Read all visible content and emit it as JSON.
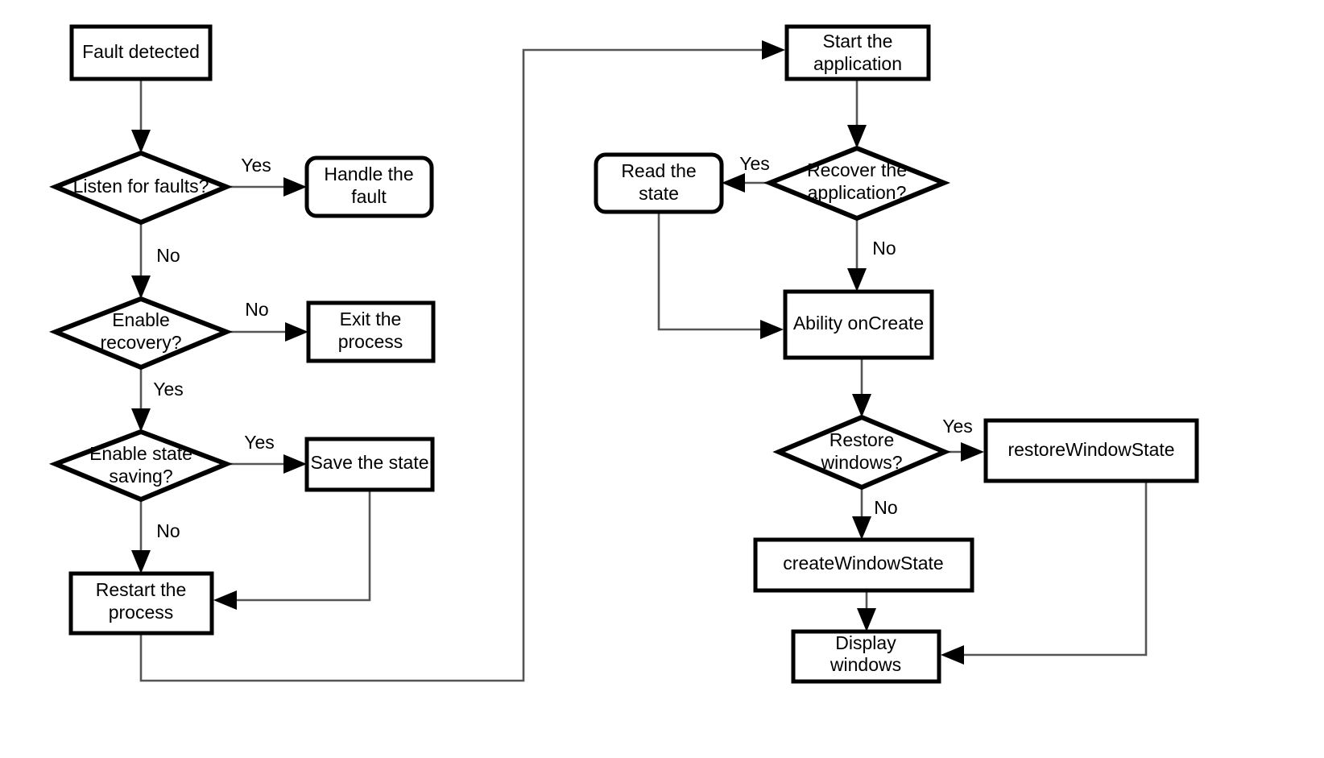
{
  "diagram": {
    "title": "Application fault recovery and window state restoration flowchart",
    "colors": {
      "node_fill": "#ffffff",
      "node_stroke": "#000000",
      "edge_stroke": "#555555",
      "text": "#000000"
    },
    "nodes": {
      "fault_detected": "Fault detected",
      "listen_for_faults": "Listen for faults?",
      "handle_the_fault_line1": "Handle the",
      "handle_the_fault_line2": "fault",
      "enable_recovery_line1": "Enable",
      "enable_recovery_line2": "recovery?",
      "exit_the_process_line1": "Exit the",
      "exit_the_process_line2": "process",
      "enable_state_saving_line1": "Enable state",
      "enable_state_saving_line2": "saving?",
      "save_the_state": "Save the state",
      "restart_the_process_line1": "Restart the",
      "restart_the_process_line2": "process",
      "start_the_application_line1": "Start the",
      "start_the_application_line2": "application",
      "recover_the_application_line1": "Recover the",
      "recover_the_application_line2": "application?",
      "read_the_state_line1": "Read the",
      "read_the_state_line2": "state",
      "ability_oncreate": "Ability onCreate",
      "restore_windows_line1": "Restore",
      "restore_windows_line2": "windows?",
      "restore_window_state": "restoreWindowState",
      "create_window_state": "createWindowState",
      "display_windows_line1": "Display",
      "display_windows_line2": "windows"
    },
    "edge_labels": {
      "listen_yes": "Yes",
      "listen_no": "No",
      "recovery_no": "No",
      "recovery_yes": "Yes",
      "state_saving_yes": "Yes",
      "state_saving_no": "No",
      "recover_app_yes": "Yes",
      "recover_app_no": "No",
      "restore_windows_yes": "Yes",
      "restore_windows_no": "No"
    }
  }
}
